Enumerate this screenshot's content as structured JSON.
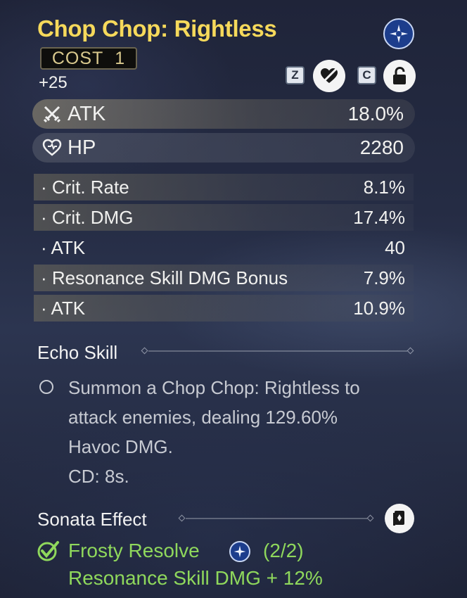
{
  "echo": {
    "name": "Chop Chop: Rightless",
    "cost_label": "COST",
    "cost_value": "1",
    "level": "+25"
  },
  "actions": {
    "lock_key": "Z",
    "discard_key": "C",
    "lock_icon": "heart-slash-icon",
    "discard_icon": "unlock-icon"
  },
  "main_stats": [
    {
      "icon": "sword-icon",
      "label": "ATK",
      "value": "18.0%"
    },
    {
      "icon": "heart-icon",
      "label": "HP",
      "value": "2280"
    }
  ],
  "sub_stats": [
    {
      "label": "· Crit. Rate",
      "value": "8.1%",
      "shaded": true
    },
    {
      "label": "· Crit. DMG",
      "value": "17.4%",
      "shaded": true
    },
    {
      "label": "· ATK",
      "value": "40",
      "shaded": false
    },
    {
      "label": "· Resonance Skill DMG Bonus",
      "value": "7.9%",
      "shaded": true
    },
    {
      "label": "· ATK",
      "value": "10.9%",
      "shaded": true
    }
  ],
  "echo_skill": {
    "title": "Echo Skill",
    "lines": [
      "Summon a Chop Chop: Rightless to",
      "attack enemies, dealing 129.60%",
      "Havoc DMG.",
      "CD: 8s."
    ]
  },
  "sonata": {
    "title": "Sonata Effect",
    "set_name": "Frosty Resolve",
    "count": "(2/2)",
    "bonus": "Resonance Skill DMG + 12%",
    "icon": "frosty-resolve-icon",
    "accent": "#8fd85c"
  }
}
